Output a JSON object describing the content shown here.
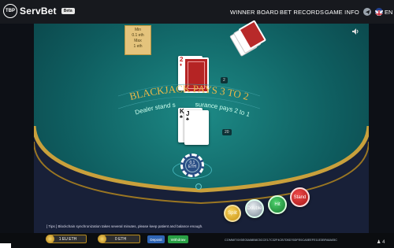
{
  "header": {
    "logo_badge": "TBP",
    "logo_text": "ServBet",
    "beta": "Beta",
    "nav": [
      "WINNER BOARD",
      "BET RECORDS",
      "GAME INFO"
    ],
    "language": "EN"
  },
  "limits": {
    "min_label": "Min",
    "min_value": "0.1 eth",
    "max_label": "Max",
    "max_value": "1 eth"
  },
  "table": {
    "banner_main": "BLACKJACK PAYS 3 TO 2",
    "banner_left": "Dealer stand s",
    "banner_right": "surance pays 2 to 1",
    "dealer_score": "2",
    "player_score": "20"
  },
  "cards": {
    "dealer": [
      {
        "rank": "2",
        "suit": "♦"
      }
    ],
    "player": [
      {
        "rank": "K",
        "suit": "♣"
      },
      {
        "rank": "J",
        "suit": "♣"
      }
    ]
  },
  "bet": {
    "chip_value": "0.1",
    "chip_unit": "ETH"
  },
  "actions": {
    "split": "Split",
    "double": "Double",
    "hit": "Hit",
    "stand": "Stand"
  },
  "info_text": "[ Tips ]  Blockchain synchronization takes several minutes, please keep patient and balance enough.",
  "balances": [
    {
      "value": "1 EU ETH"
    },
    {
      "value": "0 ETH"
    }
  ],
  "buttons": {
    "deposit": "Deposit",
    "withdraw": "Withdraw"
  },
  "commit": "COMMIT:0X5E03A58B8C5CCE17C32F4CB7D5D76DFE0CA5EEFE11E3BFA8A05C",
  "online_users": "4",
  "icons": [
    "sound-icon",
    "telegram-icon",
    "uk-flag-icon",
    "users-icon"
  ]
}
